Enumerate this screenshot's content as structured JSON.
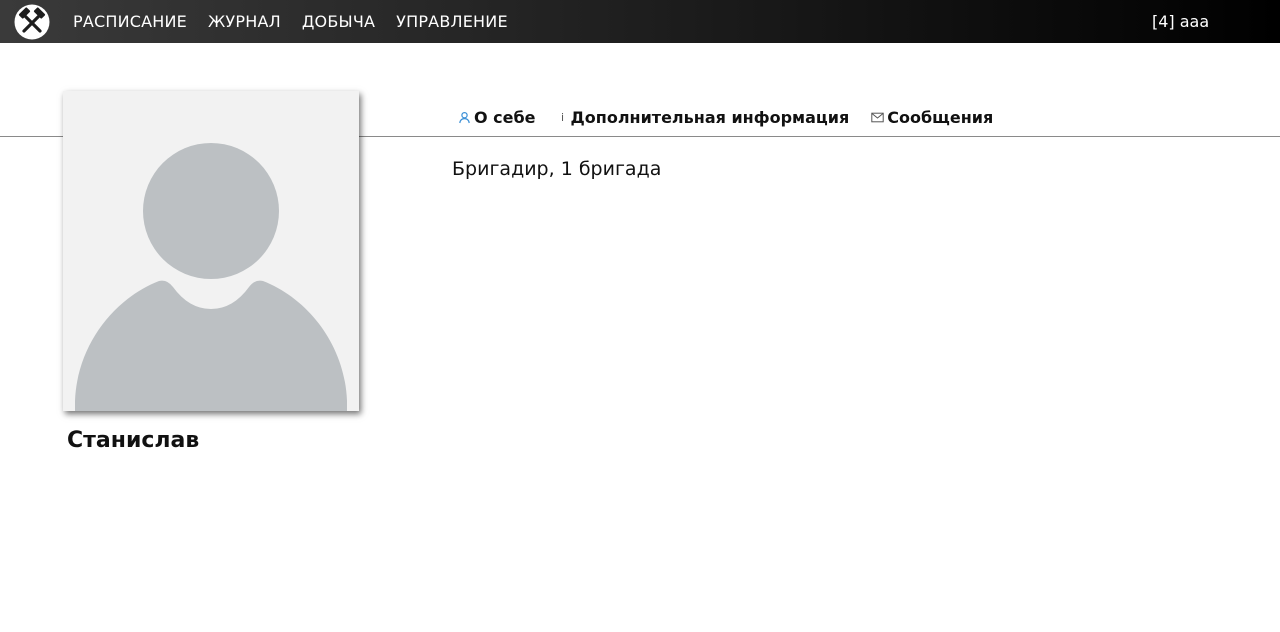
{
  "nav": {
    "logo_icon": "crossed-hammers-icon",
    "items": [
      {
        "label": "РАСПИСАНИЕ"
      },
      {
        "label": "ЖУРНАЛ"
      },
      {
        "label": "ДОБЫЧА"
      },
      {
        "label": "УПРАВЛЕНИЕ"
      }
    ],
    "user_label": "[4] aaa"
  },
  "profile": {
    "name": "Станислав",
    "avatar_icon": "user-placeholder-icon",
    "role": "Бригадир, 1 бригада"
  },
  "tabs": [
    {
      "label": "О себе",
      "icon": "user-icon",
      "icon_color": "#3a8fd6"
    },
    {
      "label": "Дополнительная информация",
      "icon": "info-icon"
    },
    {
      "label": "Сообщения",
      "icon": "envelope-icon"
    }
  ],
  "colors": {
    "topbar_start": "#3a3a3a",
    "topbar_end": "#000000",
    "avatar_bg": "#f2f2f2",
    "avatar_shape": "#bcc0c3"
  }
}
